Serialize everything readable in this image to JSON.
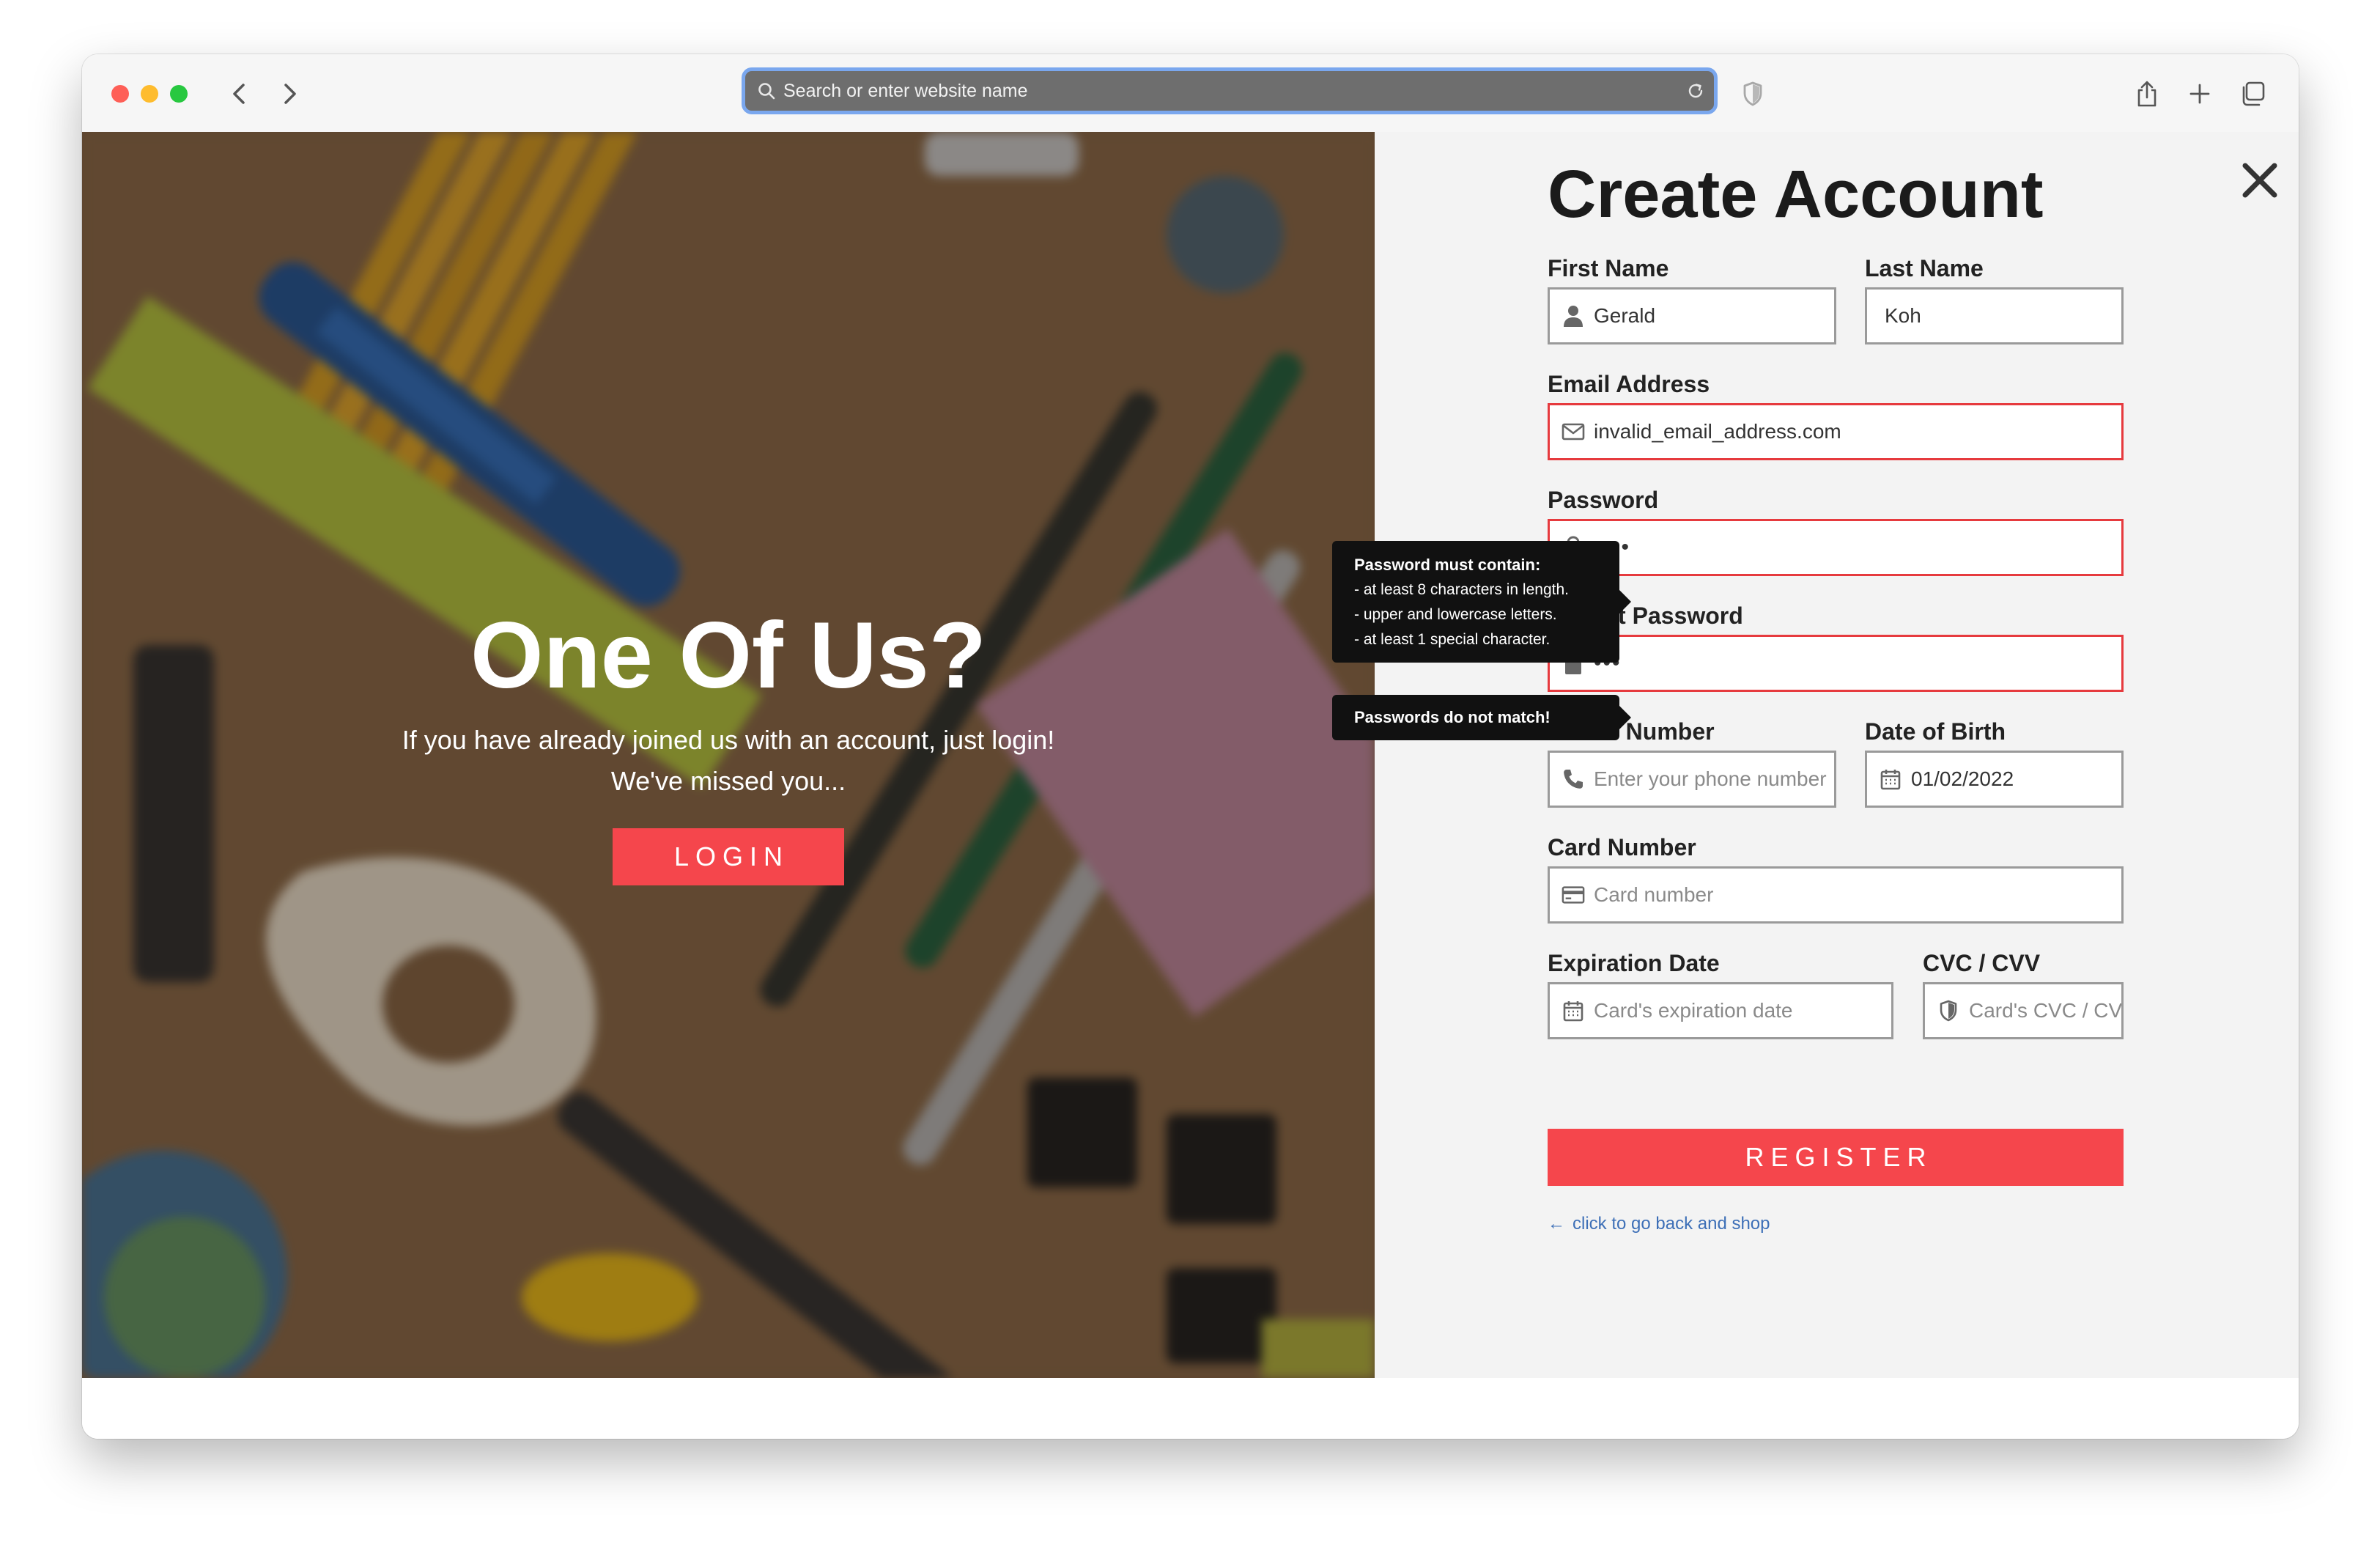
{
  "browser": {
    "address_placeholder": "Search or enter website name"
  },
  "hero": {
    "title": "One Of Us?",
    "line1": "If you have already joined us with an account, just login!",
    "line2": "We've missed you...",
    "login_label": "LOGIN"
  },
  "form": {
    "title": "Create Account",
    "first_name": {
      "label": "First Name",
      "value": "Gerald"
    },
    "last_name": {
      "label": "Last Name",
      "value": "Koh"
    },
    "email": {
      "label": "Email Address",
      "value": "invalid_email_address.com"
    },
    "password": {
      "label": "Password",
      "value": "1234"
    },
    "repeat_password": {
      "label": "Repeat Password",
      "value": "123"
    },
    "phone": {
      "label": "Phone Number",
      "placeholder": "Enter your phone number"
    },
    "dob": {
      "label": "Date of Birth",
      "value": "01/02/2022"
    },
    "card_number": {
      "label": "Card Number",
      "placeholder": "Card number"
    },
    "expiration": {
      "label": "Expiration Date",
      "placeholder": "Card's expiration date"
    },
    "cvc": {
      "label": "CVC / CVV",
      "placeholder": "Card's CVC / CVV"
    },
    "register_label": "REGISTER",
    "back_link": "click to go back and shop"
  },
  "tooltips": {
    "password_title": "Password must contain:",
    "password_rules": [
      "- at least 8 characters in length.",
      "- upper and lowercase letters.",
      "- at least 1 special character."
    ],
    "mismatch": "Passwords do not match!"
  },
  "colors": {
    "accent": "#f5464c",
    "error_border": "#e63a3e",
    "link": "#3d6fb7",
    "panel_bg": "#f3f3f3"
  },
  "icons": {
    "url": "search-icon",
    "reload": "reload-icon",
    "first_name": "user-icon",
    "email": "envelope-icon",
    "password": "lock-icon",
    "phone": "phone-icon",
    "dob": "calendar-icon",
    "card": "credit-card-icon",
    "cvc": "shield-icon",
    "close": "close-icon"
  }
}
